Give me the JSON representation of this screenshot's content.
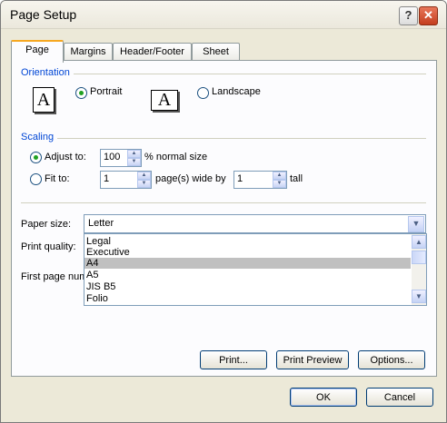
{
  "window": {
    "title": "Page Setup",
    "help_glyph": "?",
    "close_glyph": "✕"
  },
  "tabs": [
    "Page",
    "Margins",
    "Header/Footer",
    "Sheet"
  ],
  "orientation": {
    "heading": "Orientation",
    "portrait_label": "Portrait",
    "landscape_label": "Landscape",
    "selected": "portrait",
    "icon_glyph": "A"
  },
  "scaling": {
    "heading": "Scaling",
    "adjust_label": "Adjust to:",
    "adjust_value": "100",
    "adjust_suffix": "% normal size",
    "fit_label": "Fit to:",
    "fit_wide_value": "1",
    "fit_wide_suffix": "page(s) wide by",
    "fit_tall_value": "1",
    "fit_tall_suffix": "tall",
    "selected": "adjust"
  },
  "paper_size": {
    "label": "Paper size:",
    "value": "Letter",
    "options": [
      "Legal",
      "Executive",
      "A4",
      "A5",
      "JIS B5",
      "Folio"
    ],
    "highlighted": "A4"
  },
  "print_quality": {
    "label": "Print quality:"
  },
  "first_page": {
    "label": "First page num"
  },
  "buttons": {
    "print": "Print...",
    "print_preview": "Print Preview",
    "options": "Options...",
    "ok": "OK",
    "cancel": "Cancel"
  }
}
